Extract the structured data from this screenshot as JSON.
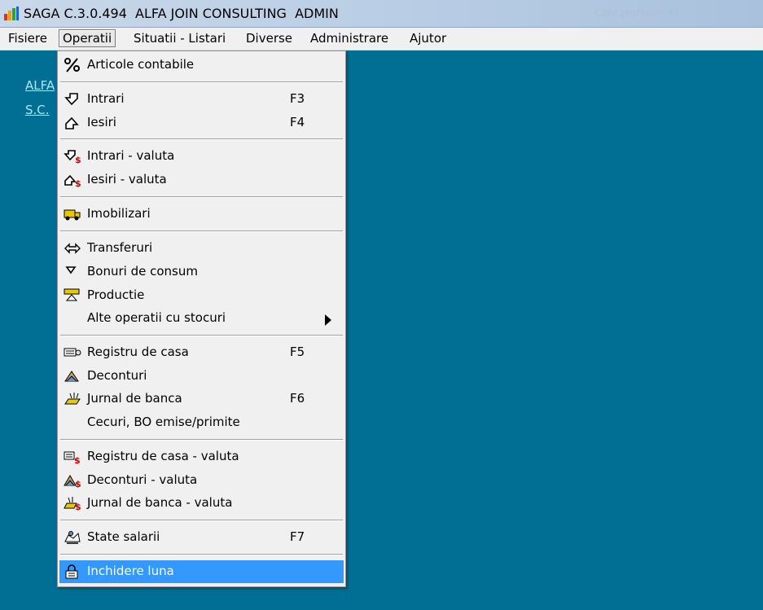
{
  "window": {
    "title": "SAGA C.3.0.494  ALFA JOIN CONSULTING  ADMIN",
    "ghost_text": "Cont profesor: R1"
  },
  "menubar": [
    "Fisiere",
    "Operatii",
    "Situatii - Listari",
    "Diverse",
    "Administrare",
    "Ajutor"
  ],
  "background": {
    "link1": "ALFA",
    "link2": "S.C."
  },
  "menu": {
    "articole": "Articole contabile",
    "intrari": "Intrari",
    "intrari_sc": "F3",
    "iesiri": "Iesiri",
    "iesiri_sc": "F4",
    "intrari_valuta": "Intrari - valuta",
    "iesiri_valuta": "Iesiri - valuta",
    "imobilizari": "Imobilizari",
    "transferuri": "Transferuri",
    "bonuri": "Bonuri de consum",
    "productie": "Productie",
    "alte_operatii": "Alte operatii cu stocuri",
    "registru_casa": "Registru de casa",
    "registru_casa_sc": "F5",
    "deconturi": "Deconturi",
    "jurnal_banca": "Jurnal de banca",
    "jurnal_banca_sc": "F6",
    "cecuri": "Cecuri, BO emise/primite",
    "registru_casa_valuta": "Registru de casa - valuta",
    "deconturi_valuta": "Deconturi - valuta",
    "jurnal_banca_valuta": "Jurnal de banca - valuta",
    "state_salarii": "State salarii",
    "state_salarii_sc": "F7",
    "inchidere_luna": "Inchidere luna"
  },
  "icons": {
    "articole": "percent-icon",
    "intrari": "arrow-in-icon",
    "iesiri": "arrow-out-icon",
    "intrari_valuta": "arrow-in-dollar-icon",
    "iesiri_valuta": "arrow-out-dollar-icon",
    "imobilizari": "truck-icon",
    "transferuri": "double-arrow-icon",
    "bonuri": "down-arrow-icon",
    "productie": "factory-icon",
    "registru_casa": "cash-register-icon",
    "deconturi": "settlement-icon",
    "jurnal_banca": "bank-icon",
    "registru_casa_valuta": "cash-register-dollar-icon",
    "deconturi_valuta": "settlement-dollar-icon",
    "jurnal_banca_valuta": "bank-dollar-icon",
    "state_salarii": "payroll-icon",
    "inchidere_luna": "lock-icon"
  },
  "colors": {
    "desktop": "#006f93",
    "highlight": "#3399ff",
    "menu_bg": "#f0f0f0"
  }
}
